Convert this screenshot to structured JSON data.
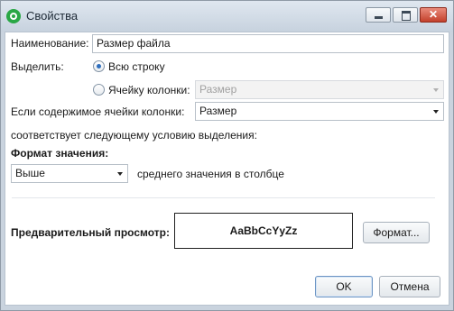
{
  "window": {
    "title": "Свойства",
    "icon": "app-icon",
    "minimize_icon": "minimize-icon",
    "maximize_icon": "maximize-icon",
    "close_icon": "close-icon",
    "close_glyph": "✕"
  },
  "form": {
    "name_label": "Наименование:",
    "name_value": "Размер файла",
    "highlight_label": "Выделить:",
    "radio_row": "Всю строку",
    "radio_cell": "Ячейку колонки:",
    "cell_column_value": "Размер",
    "condition_label": "Если содержимое ячейки колонки:",
    "condition_column_value": "Размер",
    "condition_text": "соответствует следующему условию выделения:",
    "format_label": "Формат значения:",
    "format_option": "Выше",
    "format_suffix": "среднего значения в столбце",
    "preview_label": "Предварительный просмотр:",
    "preview_text": "AaBbCcYyZz",
    "format_button": "Формат..."
  },
  "footer": {
    "ok": "OK",
    "cancel": "Отмена"
  }
}
